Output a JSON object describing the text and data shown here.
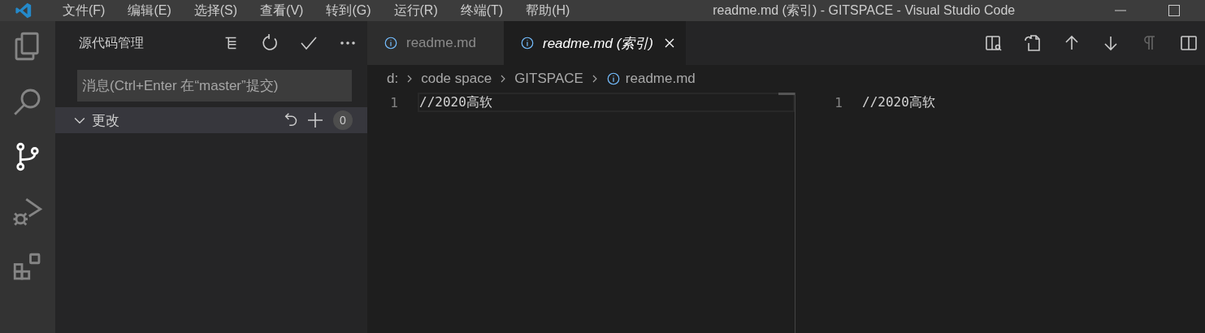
{
  "window": {
    "title": "readme.md (索引) - GITSPACE - Visual Studio Code"
  },
  "menu": [
    "文件(F)",
    "编辑(E)",
    "选择(S)",
    "查看(V)",
    "转到(G)",
    "运行(R)",
    "终端(T)",
    "帮助(H)"
  ],
  "activity_bar": [
    {
      "kind": "explorer",
      "selected": false
    },
    {
      "kind": "search",
      "selected": false
    },
    {
      "kind": "scm",
      "selected": true
    },
    {
      "kind": "debug",
      "selected": false
    },
    {
      "kind": "extensions",
      "selected": false
    }
  ],
  "sidebar": {
    "title": "源代码管理",
    "commit_message": {
      "placeholder": "消息(Ctrl+Enter 在“master”提交)"
    },
    "section": {
      "label": "更改",
      "expanded": true,
      "count": "0"
    }
  },
  "tabs": [
    {
      "label": "readme.md",
      "selected": false
    },
    {
      "label": "readme.md (索引)",
      "selected": true
    }
  ],
  "breadcrumbs": [
    "d:",
    "code space",
    "GITSPACE",
    "readme.md"
  ],
  "editor_left": {
    "lines": [
      {
        "number": "1",
        "text": "//2020高软"
      }
    ]
  },
  "editor_right": {
    "lines": [
      {
        "number": "1",
        "text": "//2020高软"
      }
    ]
  }
}
